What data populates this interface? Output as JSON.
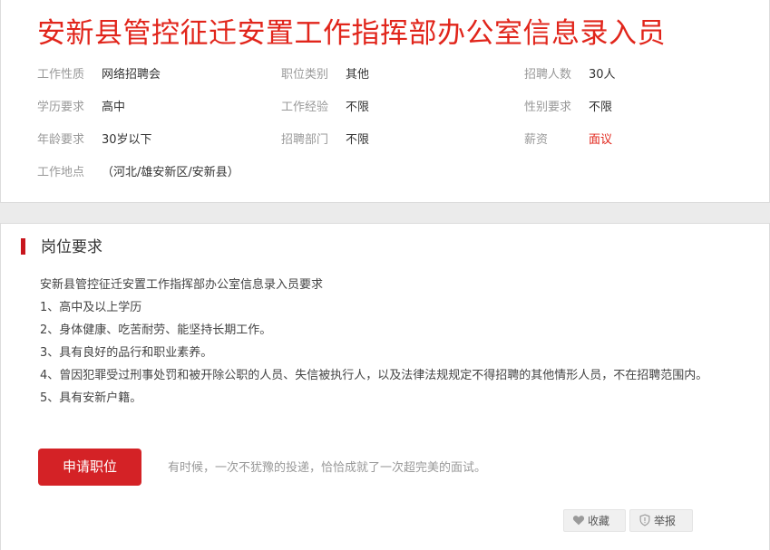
{
  "job": {
    "title": "安新县管控征迁安置工作指挥部办公室信息录入员"
  },
  "info": {
    "work_type": {
      "label": "工作性质",
      "value": "网络招聘会"
    },
    "category": {
      "label": "职位类别",
      "value": "其他"
    },
    "headcount": {
      "label": "招聘人数",
      "value": "30人"
    },
    "education": {
      "label": "学历要求",
      "value": "高中"
    },
    "experience": {
      "label": "工作经验",
      "value": "不限"
    },
    "gender": {
      "label": "性别要求",
      "value": "不限"
    },
    "age": {
      "label": "年龄要求",
      "value": "30岁以下"
    },
    "department": {
      "label": "招聘部门",
      "value": "不限"
    },
    "salary": {
      "label": "薪资",
      "value": "面议"
    },
    "location": {
      "label": "工作地点",
      "value": "（河北/雄安新区/安新县）"
    }
  },
  "requirements": {
    "heading": "岗位要求",
    "intro": "安新县管控征迁安置工作指挥部办公室信息录入员要求",
    "items": [
      "1、高中及以上学历",
      "2、身体健康、吃苦耐劳、能坚持长期工作。",
      "3、具有良好的品行和职业素养。",
      "4、曾因犯罪受过刑事处罚和被开除公职的人员、失信被执行人，以及法律法规规定不得招聘的其他情形人员，不在招聘范围内。",
      "5、具有安新户籍。"
    ]
  },
  "actions": {
    "apply_label": "申请职位",
    "slogan": "有时候，一次不犹豫的投递，恰恰成就了一次超完美的面试。",
    "favorite_label": "收藏",
    "report_label": "举报"
  },
  "icons": {
    "favorite": "heart-icon",
    "report": "shield-icon"
  },
  "colors": {
    "accent": "#e1251b",
    "button": "#d42226"
  }
}
